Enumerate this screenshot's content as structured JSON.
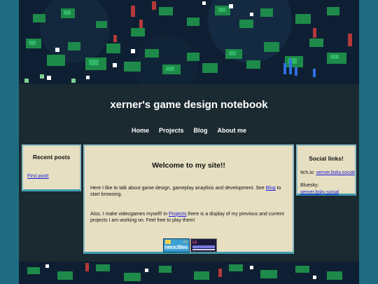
{
  "site": {
    "title": "xerner's game design notebook"
  },
  "nav": {
    "items": [
      "Home",
      "Projects",
      "Blog",
      "About me"
    ]
  },
  "recent_posts": {
    "heading": "Recent posts",
    "links": [
      "First post!"
    ]
  },
  "welcome": {
    "heading": "Welcome to my site!!",
    "p1_before": "Here I like to talk about game design, gameplay anaylisis and development. See ",
    "p1_link": "Blog",
    "p1_after": " to start browsing.",
    "p2_before": "Also, I make videogames myself! In ",
    "p2_link": "Projects",
    "p2_after": " there is a display of my previous and current projects I am working on. Feel free to play them!"
  },
  "badges": {
    "neocities_word": "neocities",
    "neocities_sub": ".org",
    "ls_word": "LS"
  },
  "social": {
    "heading": "Social links!",
    "itchio_label": "Itch.io: ",
    "itchio_link": "xerner.bsky.social",
    "bluesky_label": "Bluesky: ",
    "bluesky_link": "xerner.bsky.social"
  },
  "colors": {
    "outer_background": "#1f6c80",
    "page_background": "#1a2a30",
    "panel_background": "#e6dfc2",
    "panel_border": "#3d9db0",
    "link": "#1a1ad8"
  }
}
